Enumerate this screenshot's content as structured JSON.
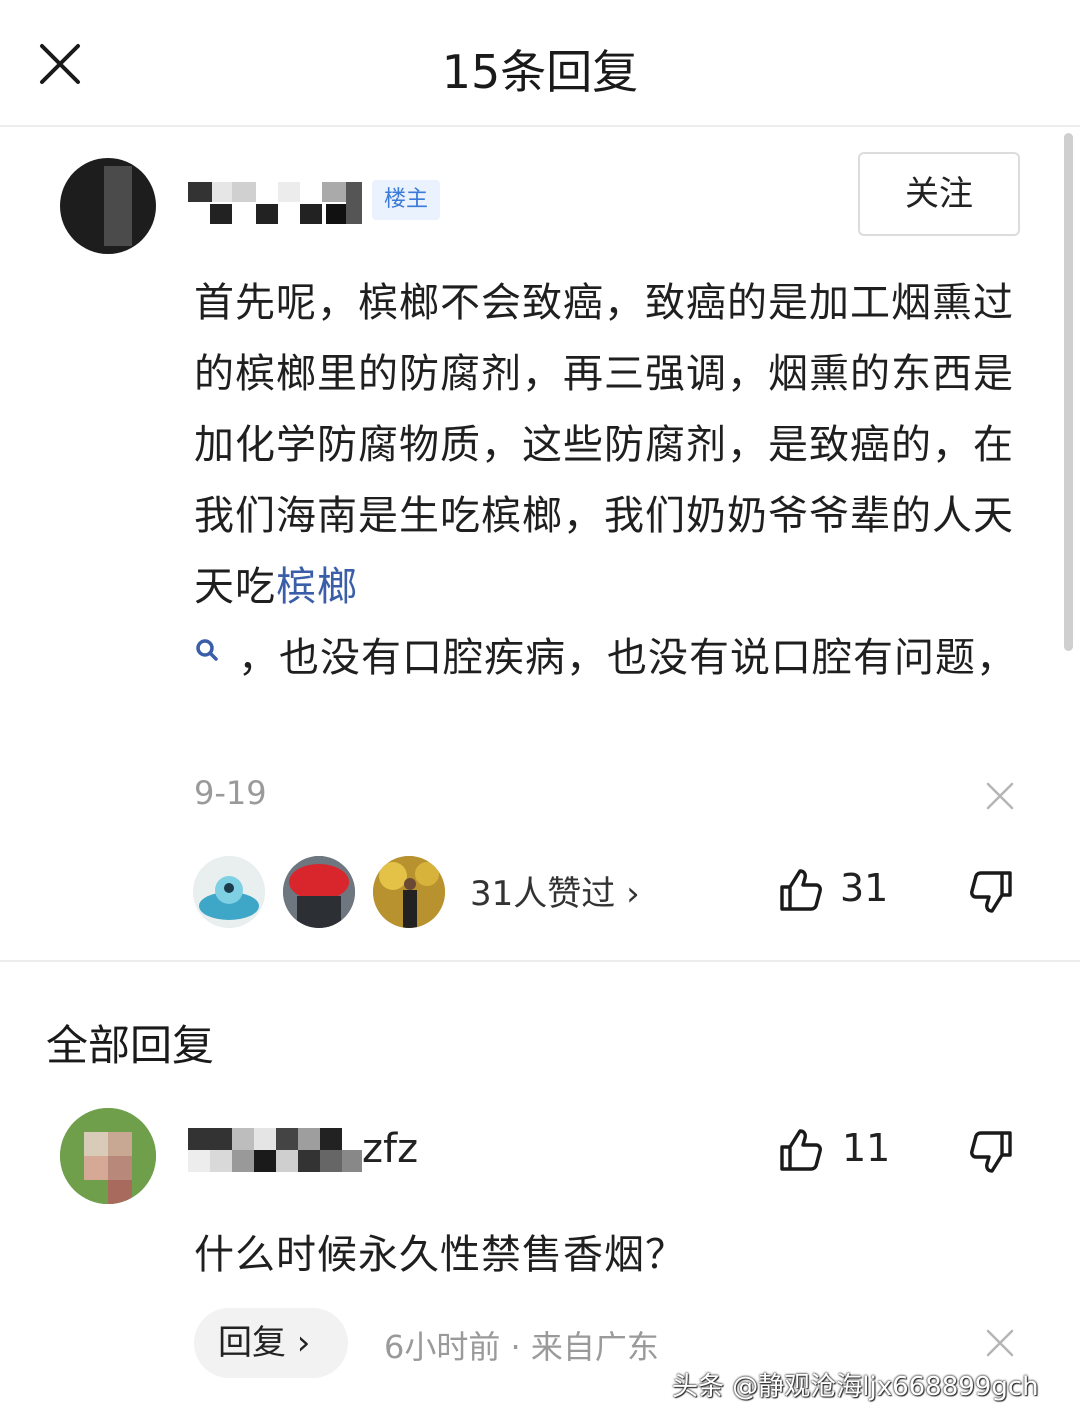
{
  "header": {
    "title": "15条回复"
  },
  "main_comment": {
    "host_badge": "楼主",
    "follow_label": "关注",
    "text_before_link": "首先呢，槟榔不会致癌，致癌的是加工烟熏过的槟榔里的防腐剂，再三强调，烟熏的东西是加化学防腐物质，这些防腐剂，是致癌的，在我们海南是生吃槟榔，我们奶奶爷爷辈的人天天吃",
    "link_text": "槟榔",
    "text_after_link": "，也没有口腔疾病，也没有说口腔有问题，",
    "date": "9-19",
    "likes_summary": "31人赞过 ›",
    "like_count": "31"
  },
  "section_title": "全部回复",
  "reply": {
    "name_visible_suffix": "zfz",
    "text": "什么时候永久性禁售香烟？",
    "like_count": "11",
    "reply_button_label": "回复 ›",
    "meta": "6小时前 · 来自广东"
  },
  "watermark": "头条 @静观沧海ljx668899gch",
  "colors": {
    "link": "#3a5fa8",
    "badge_bg": "#e9f2fd",
    "badge_text": "#3a7ad8",
    "meta_gray": "#9a9a9a"
  }
}
